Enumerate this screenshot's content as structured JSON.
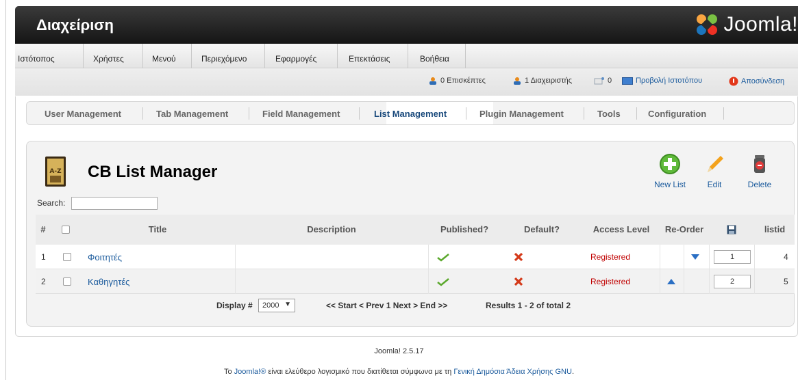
{
  "header": {
    "title": "Διαχείριση",
    "brand": "Joomla!"
  },
  "menu": {
    "items": [
      "Ιστότοπος",
      "Χρήστες",
      "Μενού",
      "Περιεχόμενο",
      "Εφαρμογές",
      "Επεκτάσεις",
      "Βοήθεια"
    ]
  },
  "status": {
    "visitors": "0 Επισκέπτες",
    "admins": "1 Διαχειριστής",
    "messages": "0",
    "view_site": "Προβολή Ιστοτόπου",
    "logout": "Αποσύνδεση"
  },
  "submenu": {
    "items": [
      "User Management",
      "Tab Management",
      "Field Management",
      "List Management",
      "Plugin Management",
      "Tools",
      "Configuration"
    ],
    "active": "List Management"
  },
  "page": {
    "title": "CB List Manager"
  },
  "toolbar": {
    "new_label": "New List",
    "edit_label": "Edit",
    "delete_label": "Delete"
  },
  "search": {
    "label": "Search:",
    "value": ""
  },
  "table": {
    "headers": {
      "num": "#",
      "title": "Title",
      "description": "Description",
      "published": "Published?",
      "default": "Default?",
      "access": "Access Level",
      "reorder": "Re-Order",
      "listid": "listid"
    },
    "rows": [
      {
        "num": "1",
        "title": "Φοιτητές",
        "description": "",
        "published": true,
        "default": false,
        "access": "Registered",
        "order": "1",
        "listid": "4"
      },
      {
        "num": "2",
        "title": "Καθηγητές",
        "description": "",
        "published": true,
        "default": false,
        "access": "Registered",
        "order": "2",
        "listid": "5"
      }
    ]
  },
  "pagination": {
    "display_label": "Display #",
    "display_value": "2000",
    "nav": "<< Start < Prev 1 Next > End >>",
    "results": "Results 1 - 2 of total 2"
  },
  "footer": {
    "version": "Joomla! 2.5.17",
    "copyright_prefix": "Το ",
    "copyright_joomla": "Joomla!®",
    "copyright_middle": " είναι ελεύθερο λογισμικό που διατίθεται σύμφωνα με τη ",
    "copyright_license": "Γενική Δημόσια Άδεια Χρήσης GNU",
    "copyright_suffix": "."
  },
  "colors": {
    "link": "#1a5a9c",
    "access": "#c00000",
    "published": "#5aa82b",
    "default_no": "#d43a1a"
  }
}
